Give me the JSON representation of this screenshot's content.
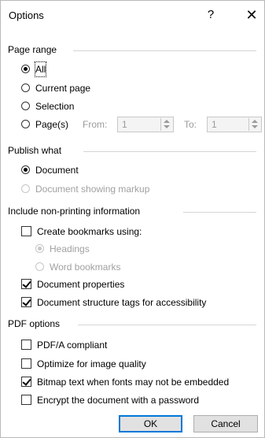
{
  "window": {
    "title": "Options",
    "help_glyph": "?",
    "close_glyph": "✕"
  },
  "page_range": {
    "header": "Page range",
    "all": "All",
    "current_page": "Current page",
    "selection": "Selection",
    "pages": "Page(s)",
    "from_label": "From:",
    "from_value": "1",
    "to_label": "To:",
    "to_value": "1"
  },
  "publish_what": {
    "header": "Publish what",
    "document": "Document",
    "document_markup": "Document showing markup"
  },
  "non_printing": {
    "header": "Include non-printing information",
    "create_bookmarks": "Create bookmarks using:",
    "headings": "Headings",
    "word_bookmarks": "Word bookmarks",
    "doc_properties": "Document properties",
    "doc_structure": "Document structure tags for accessibility"
  },
  "pdf_options": {
    "header": "PDF options",
    "pdfa": "PDF/A compliant",
    "optimize": "Optimize for image quality",
    "bitmap": "Bitmap text when fonts may not be embedded",
    "encrypt": "Encrypt the document with a password"
  },
  "buttons": {
    "ok": "OK",
    "cancel": "Cancel"
  },
  "colors": {
    "accent": "#0078d7",
    "disabled": "#a0a0a0"
  }
}
